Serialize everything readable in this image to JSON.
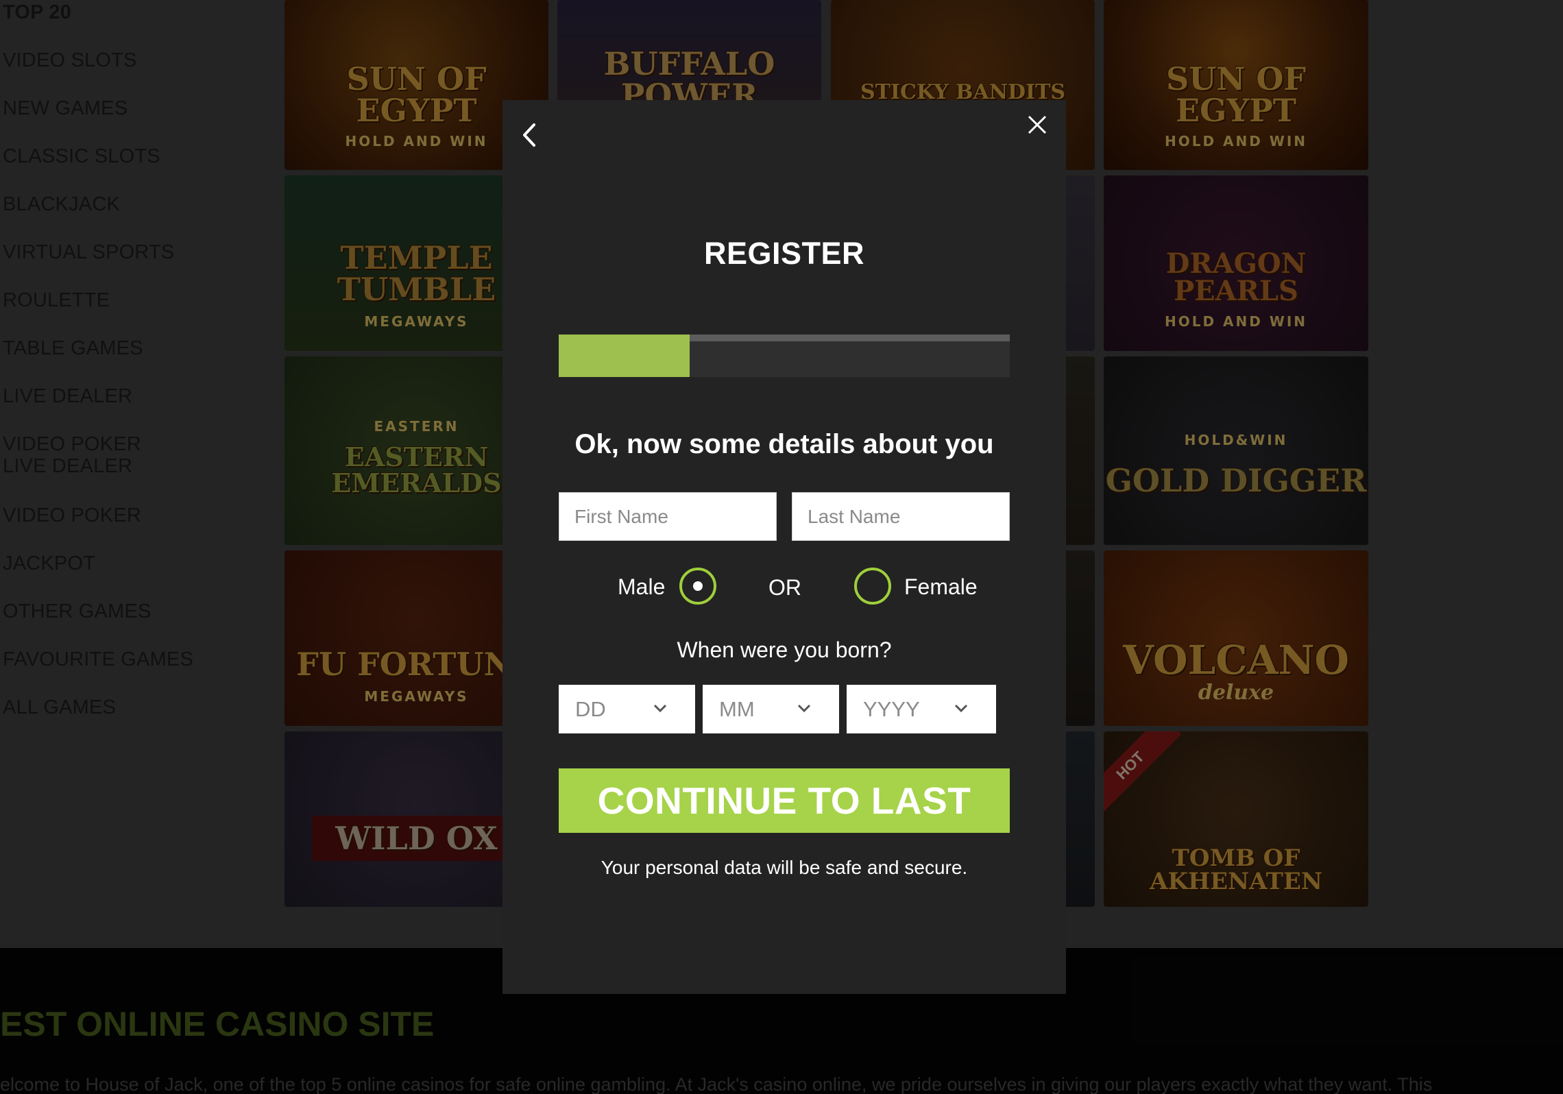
{
  "sidebar": {
    "items": [
      {
        "label": "TOP 20"
      },
      {
        "label": "VIDEO SLOTS"
      },
      {
        "label": "NEW GAMES"
      },
      {
        "label": "CLASSIC SLOTS"
      },
      {
        "label": "BLACKJACK"
      },
      {
        "label": "VIRTUAL SPORTS"
      },
      {
        "label": "ROULETTE"
      },
      {
        "label": "TABLE GAMES"
      },
      {
        "label": "LIVE DEALER"
      },
      {
        "label": "VIDEO POKER"
      },
      {
        "label": "LIVE DEALER"
      },
      {
        "label": "VIDEO POKER"
      },
      {
        "label": "JACKPOT"
      },
      {
        "label": "OTHER GAMES"
      },
      {
        "label": "FAVOURITE GAMES"
      },
      {
        "label": "ALL GAMES"
      }
    ]
  },
  "games": [
    {
      "title": "SUN OF EGYPT",
      "subtitle": "HOLD AND WIN"
    },
    {
      "title": "BUFFALO POWER",
      "subtitle": ""
    },
    {
      "title": "STICKY BANDITS",
      "subtitle": ""
    },
    {
      "title": "SUN OF EGYPT",
      "subtitle": "HOLD AND WIN"
    },
    {
      "title": "TEMPLE TUMBLE",
      "subtitle": "MEGAWAYS"
    },
    {
      "title": "DRAGON PEARLS",
      "subtitle": "HOLD AND WIN"
    },
    {
      "title": "EASTERN EMERALDS",
      "subtitle": "EASTERN"
    },
    {
      "title": "GOLD DIGGER",
      "subtitle": "HOLD&WIN"
    },
    {
      "title": "FU FORTUNE",
      "subtitle": "MEGAWAYS"
    },
    {
      "title": "VOLCANO",
      "subtitle": "deluxe"
    },
    {
      "title": "WILD OX",
      "subtitle": ""
    },
    {
      "title": "TOMB OF AKHENATEN",
      "subtitle": "",
      "badge": "HOT"
    }
  ],
  "footer": {
    "heading": "EST ONLINE CASINO SITE",
    "text": "elcome to House of Jack, one of the top 5 online casinos for safe online gambling. At Jack's casino online, we pride ourselves in giving our players exactly what they want. This"
  },
  "modal": {
    "title": "REGISTER",
    "progress": 0.29,
    "subheading": "Ok, now some details about you",
    "first_name_placeholder": "First Name",
    "last_name_placeholder": "Last Name",
    "gender": {
      "male_label": "Male",
      "or_label": "OR",
      "female_label": "Female",
      "selected": "Male"
    },
    "born_label": "When were you born?",
    "dob": {
      "day_placeholder": "DD",
      "month_placeholder": "MM",
      "year_placeholder": "YYYY"
    },
    "continue_label": "CONTINUE TO LAST",
    "secure_note": "Your personal data will be safe and secure."
  },
  "colors": {
    "accent": "#a6d34a",
    "progress_fill": "#9dc04e",
    "radio_ring": "#9fcf3b",
    "modal_bg": "#232323"
  }
}
